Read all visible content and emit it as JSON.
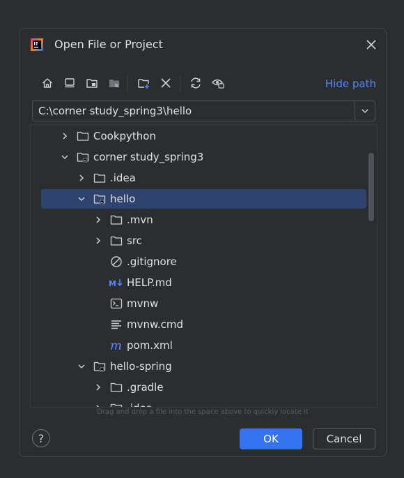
{
  "dialog": {
    "title": "Open File or Project",
    "hide_path_label": "Hide path",
    "path_value": "C:\\corner study_spring3\\hello",
    "hint": "Drag and drop a file into the space above to quickly locate it",
    "help_label": "?",
    "ok_label": "OK",
    "cancel_label": "Cancel"
  },
  "toolbar": {
    "buttons": [
      "home-icon",
      "desktop-icon",
      "project-folder-icon",
      "module-folder-icon",
      "new-folder-icon",
      "delete-icon",
      "refresh-icon",
      "show-hidden-icon"
    ]
  },
  "tree": {
    "rows": [
      {
        "label": "Cookpython",
        "icon": "folder-icon",
        "chevron": "right"
      },
      {
        "label": "corner study_spring3",
        "icon": "project-folder-icon",
        "chevron": "down"
      },
      {
        "label": ".idea",
        "icon": "folder-icon",
        "chevron": "right"
      },
      {
        "label": "hello",
        "icon": "project-folder-icon",
        "chevron": "down",
        "selected": true
      },
      {
        "label": ".mvn",
        "icon": "folder-icon",
        "chevron": "right"
      },
      {
        "label": "src",
        "icon": "folder-icon",
        "chevron": "right"
      },
      {
        "label": ".gitignore",
        "icon": "ignore-file-icon",
        "chevron": "none"
      },
      {
        "label": "HELP.md",
        "icon": "markdown-icon",
        "chevron": "none"
      },
      {
        "label": "mvnw",
        "icon": "shell-script-icon",
        "chevron": "none"
      },
      {
        "label": "mvnw.cmd",
        "icon": "text-file-icon",
        "chevron": "none"
      },
      {
        "label": "pom.xml",
        "icon": "maven-icon",
        "chevron": "none"
      },
      {
        "label": "hello-spring",
        "icon": "project-folder-icon",
        "chevron": "down"
      },
      {
        "label": ".gradle",
        "icon": "folder-icon",
        "chevron": "right"
      },
      {
        "label": ".idea",
        "icon": "folder-icon",
        "chevron": "right"
      }
    ]
  },
  "colors": {
    "background": "#2b2d30",
    "selection": "#2e436e",
    "accent": "#3574f0",
    "link": "#548af7",
    "text": "#dfe1e5"
  }
}
